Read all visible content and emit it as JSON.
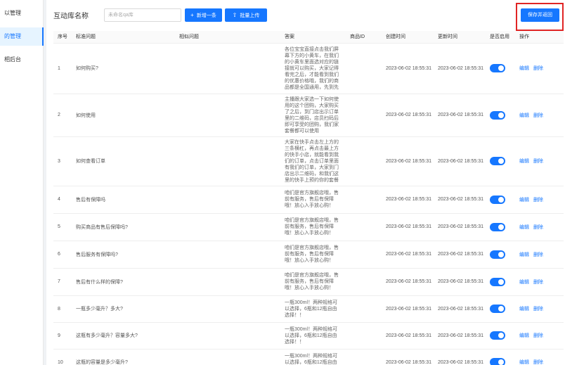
{
  "sidebar": {
    "items": [
      {
        "label": "以管理"
      },
      {
        "label": "的管理"
      },
      {
        "label": "相后台"
      }
    ]
  },
  "toolbar": {
    "library_label": "互动库名称",
    "library_placeholder": "未命名qa库",
    "new_label": "新增一条",
    "upload_label": "批量上传",
    "save_label": "保存并返回"
  },
  "table": {
    "headers": [
      "序号",
      "标准问题",
      "相似问题",
      "答案",
      "商品ID",
      "创建时间",
      "更新时间",
      "是否启用",
      "操作"
    ],
    "action_edit": "编辑",
    "action_delete": "删除",
    "rows": [
      {
        "index": "1",
        "question": "如何购买?",
        "similar": "",
        "answer": "各位宝宝直接点击我们屏幕下方的小黄车，在我们的小黄车里面选对应的链接就可以购买，大家记得看完之后，才能看到我们的优惠价格哦，我们的商品都是全国通用，先到先得直接拍下哦",
        "product_id": "",
        "created": "2023-06-02 18:55:31",
        "updated": "2023-06-02 18:55:31",
        "enabled": true
      },
      {
        "index": "2",
        "question": "如何使用",
        "similar": "",
        "answer": "主播跟大家选一下如何使用的这个团购，大家购买了之后，到门店出示订单里的二维码，店员扫码后即可享受的团购，我们家套餐都可以使用",
        "product_id": "",
        "created": "2023-06-02 18:55:31",
        "updated": "2023-06-02 18:55:31",
        "enabled": true
      },
      {
        "index": "3",
        "question": "如何查看订单",
        "similar": "",
        "answer": "大家在快手点击左上方的三条横杠，再点击最上方的快手小店，就能看到我们的订单，点击订单里面有我们的订单，大家到门店出示二维码，和我们这里的快手上预约你的套餐的链接哦",
        "product_id": "",
        "created": "2023-06-02 18:55:31",
        "updated": "2023-06-02 18:55:31",
        "enabled": true
      },
      {
        "index": "4",
        "question": "售后有保障吗",
        "similar": "",
        "answer": "咱们是官方旗舰店哦，售前有服务，售后有保障哦！放心入手放心购！",
        "product_id": "",
        "created": "2023-06-02 18:55:31",
        "updated": "2023-06-02 18:55:31",
        "enabled": true
      },
      {
        "index": "5",
        "question": "购买商品有售后保障吗?",
        "similar": "",
        "answer": "咱们是官方旗舰店哦，售前有服务，售后有保障哦！放心入手放心购！",
        "product_id": "",
        "created": "2023-06-02 18:55:31",
        "updated": "2023-06-02 18:55:31",
        "enabled": true
      },
      {
        "index": "6",
        "question": "售后服务有保障吗?",
        "similar": "",
        "answer": "咱们是官方旗舰店哦，售前有服务，售后有保障哦！放心入手放心购！",
        "product_id": "",
        "created": "2023-06-02 18:55:31",
        "updated": "2023-06-02 18:55:31",
        "enabled": true
      },
      {
        "index": "7",
        "question": "售后有什么样的保障?",
        "similar": "",
        "answer": "咱们是官方旗舰店哦，售前有服务，售后有保障哦！放心入手放心购！",
        "product_id": "",
        "created": "2023-06-02 18:55:31",
        "updated": "2023-06-02 18:55:31",
        "enabled": true
      },
      {
        "index": "8",
        "question": "一瓶多少毫升？多大?",
        "similar": "",
        "answer": "一瓶300ml！两种规格可以选择，6瓶和12瓶自由选择！！",
        "product_id": "",
        "created": "2023-06-02 18:55:31",
        "updated": "2023-06-02 18:55:31",
        "enabled": true
      },
      {
        "index": "9",
        "question": "这瓶有多少毫升？容量多大?",
        "similar": "",
        "answer": "一瓶300ml！两种规格可以选择，6瓶和12瓶自由选择！！",
        "product_id": "",
        "created": "2023-06-02 18:55:31",
        "updated": "2023-06-02 18:55:31",
        "enabled": true
      },
      {
        "index": "10",
        "question": "这瓶的容量是多少毫升?",
        "similar": "",
        "answer": "一瓶300ml！两种规格可以选择，6瓶和12瓶自由选择！！",
        "product_id": "",
        "created": "2023-06-02 18:55:31",
        "updated": "2023-06-02 18:55:31",
        "enabled": true
      }
    ]
  },
  "colors": {
    "accent": "#1677ff",
    "highlight_border": "#e02424"
  },
  "icons": {
    "new": "plus-icon",
    "upload": "upload-icon"
  }
}
